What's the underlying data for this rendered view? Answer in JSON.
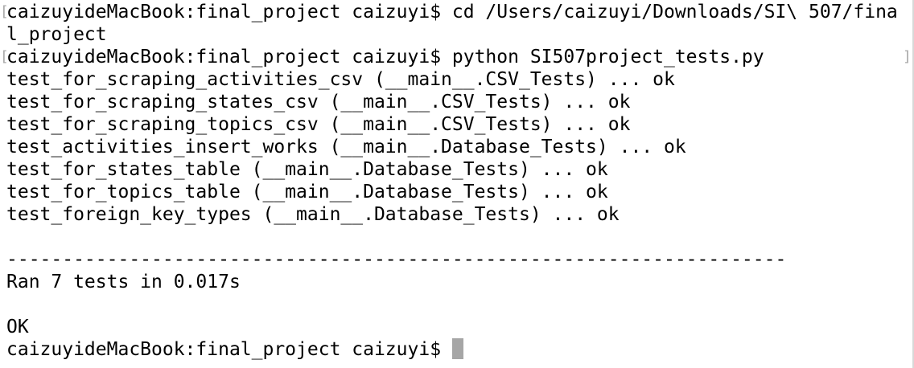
{
  "terminal": {
    "lines": [
      "caizuyideMacBook:final_project caizuyi$ cd /Users/caizuyi/Downloads/SI\\ 507/fina",
      "l_project",
      "caizuyideMacBook:final_project caizuyi$ python SI507project_tests.py",
      "test_for_scraping_activities_csv (__main__.CSV_Tests) ... ok",
      "test_for_scraping_states_csv (__main__.CSV_Tests) ... ok",
      "test_for_scraping_topics_csv (__main__.CSV_Tests) ... ok",
      "test_activities_insert_works (__main__.Database_Tests) ... ok",
      "test_for_states_table (__main__.Database_Tests) ... ok",
      "test_for_topics_table (__main__.Database_Tests) ... ok",
      "test_foreign_key_types (__main__.Database_Tests) ... ok",
      "",
      "----------------------------------------------------------------------",
      "Ran 7 tests in 0.017s",
      "",
      "OK",
      "caizuyideMacBook:final_project caizuyi$ "
    ],
    "markers": {
      "left_bracket": "[",
      "right_bracket": "]"
    },
    "colors": {
      "background": "#ffffff",
      "text": "#000000",
      "cursor": "#a6a6a6",
      "marker": "#a8a8a8"
    }
  }
}
